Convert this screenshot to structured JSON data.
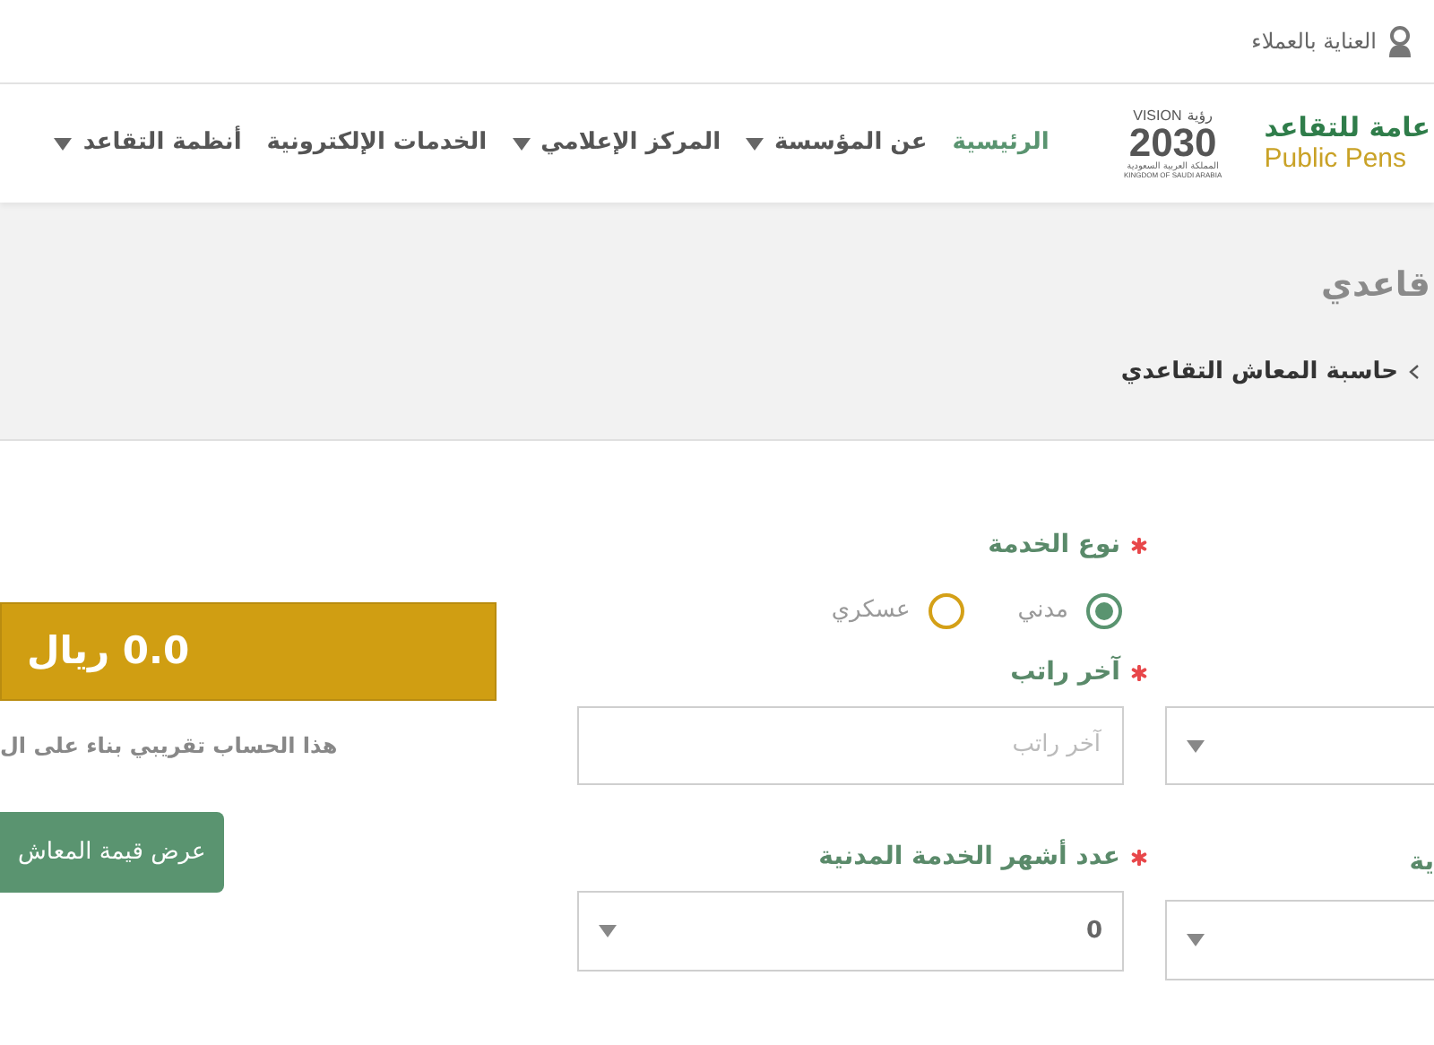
{
  "top_bar": {
    "customer_care": "العناية بالعملاء"
  },
  "logo": {
    "arabic": "عامة للتقاعد",
    "english": "Public Pens"
  },
  "vision_logo": {
    "vision": "VISION",
    "arabic_word": "رؤية",
    "year": "2030",
    "kingdom_arabic": "المملكة العربية السعودية",
    "kingdom_english": "KINGDOM OF SAUDI ARABIA"
  },
  "nav": [
    {
      "label": "الرئيسية",
      "selected": true,
      "dropdown": false
    },
    {
      "label": "عن المؤسسة",
      "selected": false,
      "dropdown": true
    },
    {
      "label": "المركز الإعلامي",
      "selected": false,
      "dropdown": true
    },
    {
      "label": "الخدمات الإلكترونية",
      "selected": false,
      "dropdown": false
    },
    {
      "label": "أنظمة التقاعد",
      "selected": false,
      "dropdown": true
    }
  ],
  "page_header": {
    "title": "قاعدي",
    "breadcrumb": "حاسبة المعاش التقاعدي"
  },
  "form": {
    "service_type": {
      "label": "نوع الخدمة",
      "required": true,
      "options": [
        {
          "label": "مدني",
          "selected": true
        },
        {
          "label": "عسكري",
          "selected": false
        }
      ]
    },
    "last_salary": {
      "label": "آخر راتب",
      "required": true,
      "placeholder": "آخر راتب"
    },
    "civil_months": {
      "label": "عدد أشهر الخدمة المدنية",
      "required": true,
      "value": "0"
    },
    "column_2_label": "ية"
  },
  "result": {
    "amount": "0.0 ريال",
    "note": "هذا الحساب تقريبي بناء على ال",
    "button": "عرض قيمة المعاش"
  }
}
